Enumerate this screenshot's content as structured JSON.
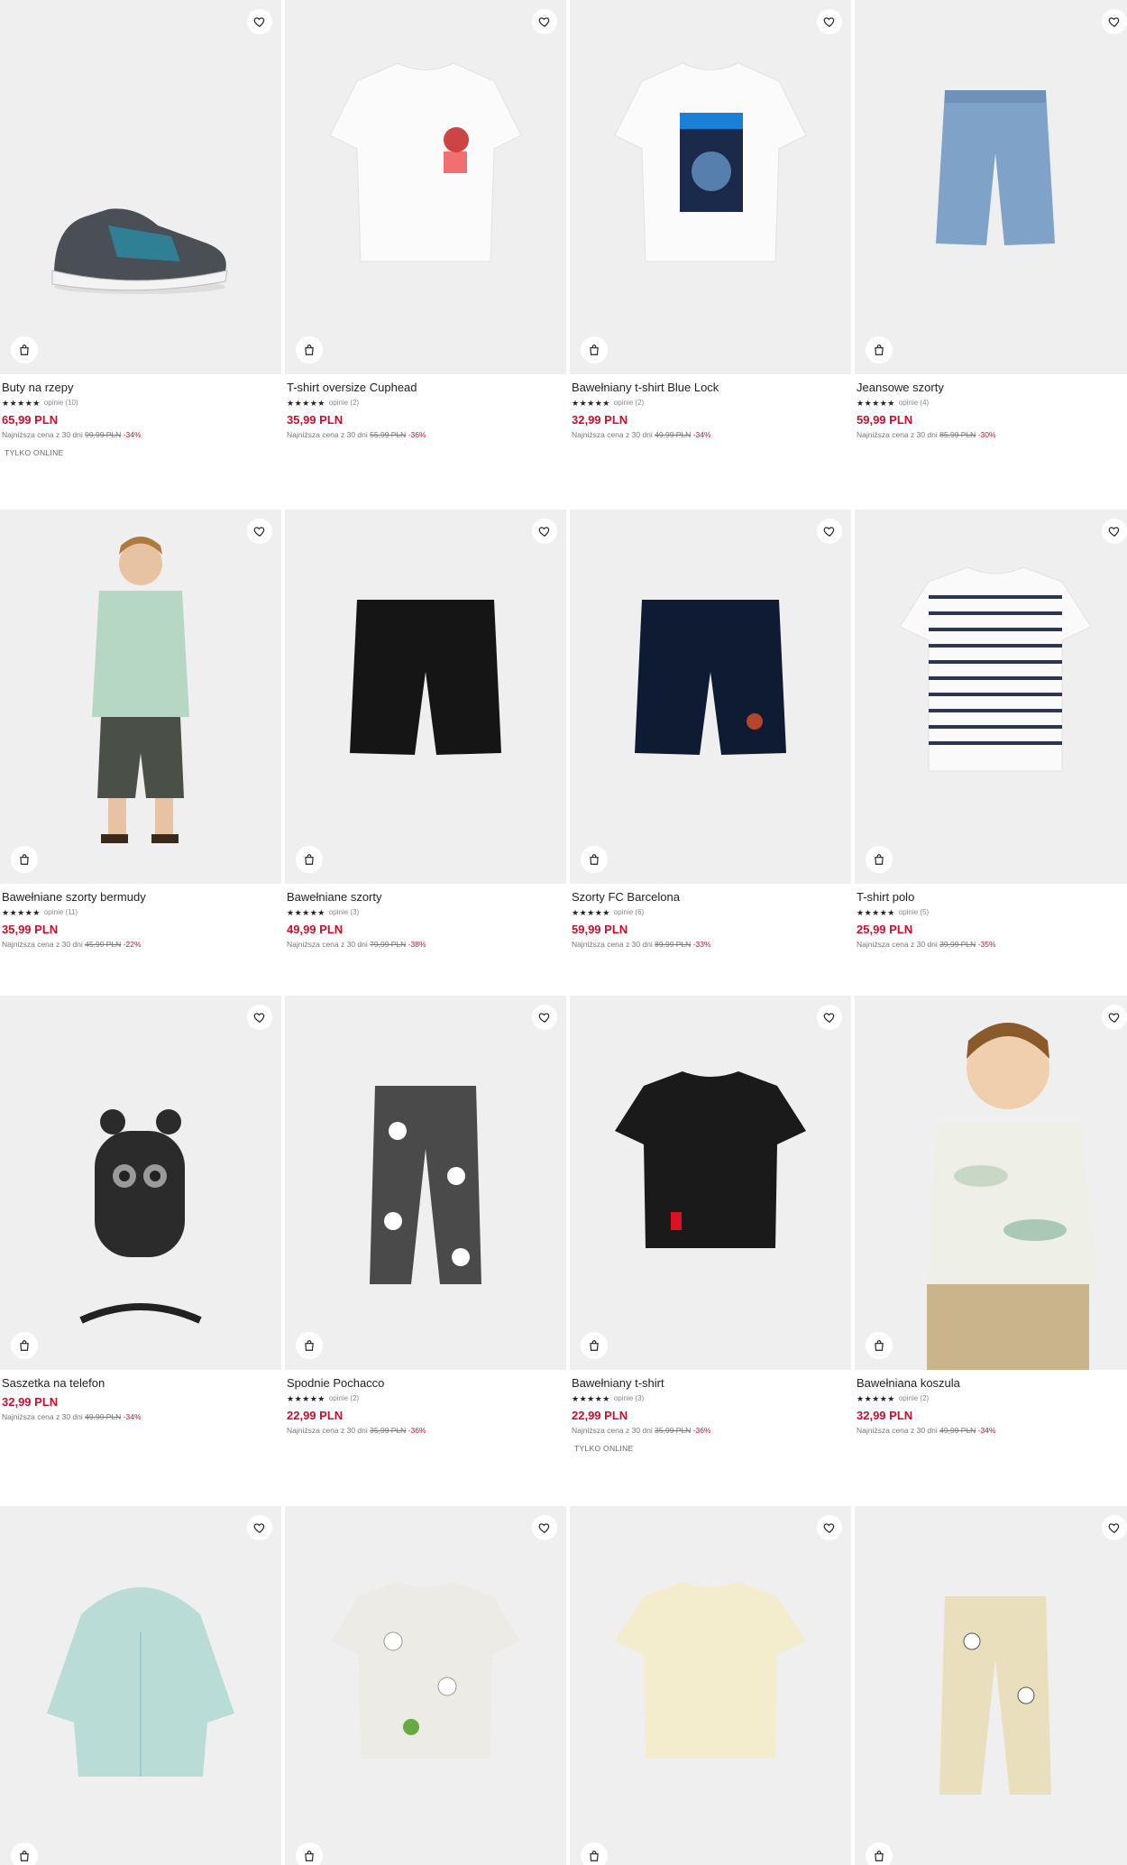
{
  "colors": {
    "price": "#c8102e",
    "image_bg": "#efefef"
  },
  "icons": {
    "favorite": "heart-icon",
    "add_to_cart": "shopping-bag-icon"
  },
  "products": [
    {
      "name": "Buty na rzepy",
      "stars": "★★★★★",
      "reviews": "opinie (10)",
      "price": "65,99 PLN",
      "lowest_label": "Najniższa cena z 30 dni",
      "old_price": "99,99 PLN",
      "discount": "-34%",
      "badge": "TYLKO ONLINE",
      "kind": "shoe"
    },
    {
      "name": "T-shirt oversize Cuphead",
      "stars": "★★★★★",
      "reviews": "opinie (2)",
      "price": "35,99 PLN",
      "lowest_label": "Najniższa cena z 30 dni",
      "old_price": "55,99 PLN",
      "discount": "-36%",
      "kind": "tee-white-print"
    },
    {
      "name": "Bawełniany t-shirt Blue Lock",
      "stars": "★★★★★",
      "reviews": "opinie (2)",
      "price": "32,99 PLN",
      "lowest_label": "Najniższa cena z 30 dni",
      "old_price": "49,99 PLN",
      "discount": "-34%",
      "kind": "tee-white-poster"
    },
    {
      "name": "Jeansowe szorty",
      "stars": "★★★★★",
      "reviews": "opinie (4)",
      "price": "59,99 PLN",
      "lowest_label": "Najniższa cena z 30 dni",
      "old_price": "85,99 PLN",
      "discount": "-30%",
      "kind": "denim-shorts"
    },
    {
      "name": "Bawełniane szorty bermudy",
      "stars": "★★★★★",
      "reviews": "opinie (11)",
      "price": "35,99 PLN",
      "lowest_label": "Najniższa cena z 30 dni",
      "old_price": "45,99 PLN",
      "discount": "-22%",
      "kind": "kid-model"
    },
    {
      "name": "Bawełniane szorty",
      "stars": "★★★★★",
      "reviews": "opinie (3)",
      "price": "49,99 PLN",
      "lowest_label": "Najniższa cena z 30 dni",
      "old_price": "79,99 PLN",
      "discount": "-38%",
      "kind": "black-shorts"
    },
    {
      "name": "Szorty FC Barcelona",
      "stars": "★★★★★",
      "reviews": "opinie (6)",
      "price": "59,99 PLN",
      "lowest_label": "Najniższa cena z 30 dni",
      "old_price": "89,99 PLN",
      "discount": "-33%",
      "kind": "navy-shorts"
    },
    {
      "name": "T-shirt polo",
      "stars": "★★★★★",
      "reviews": "opinie (5)",
      "price": "25,99 PLN",
      "lowest_label": "Najniższa cena z 30 dni",
      "old_price": "39,99 PLN",
      "discount": "-35%",
      "kind": "striped-polo"
    },
    {
      "name": "Saszetka na telefon",
      "price": "32,99 PLN",
      "lowest_label": "Najniższa cena z 30 dni",
      "old_price": "49,99 PLN",
      "discount": "-34%",
      "kind": "bag"
    },
    {
      "name": "Spodnie Pochacco",
      "stars": "★★★★★",
      "reviews": "opinie (2)",
      "price": "22,99 PLN",
      "lowest_label": "Najniższa cena z 30 dni",
      "old_price": "35,99 PLN",
      "discount": "-36%",
      "kind": "grey-pants"
    },
    {
      "name": "Bawełniany t-shirt",
      "stars": "★★★★★",
      "reviews": "opinie (3)",
      "price": "22,99 PLN",
      "lowest_label": "Najniższa cena z 30 dni",
      "old_price": "35,99 PLN",
      "discount": "-36%",
      "badge": "TYLKO ONLINE",
      "kind": "black-tee"
    },
    {
      "name": "Bawełniana koszula",
      "stars": "★★★★★",
      "reviews": "opinie (2)",
      "price": "32,99 PLN",
      "lowest_label": "Najniższa cena z 30 dni",
      "old_price": "49,99 PLN",
      "discount": "-34%",
      "kind": "kid-shirt"
    },
    {
      "kind": "mint-hoodie"
    },
    {
      "kind": "print-tee"
    },
    {
      "kind": "cream-polo"
    },
    {
      "kind": "beige-joggers"
    }
  ]
}
